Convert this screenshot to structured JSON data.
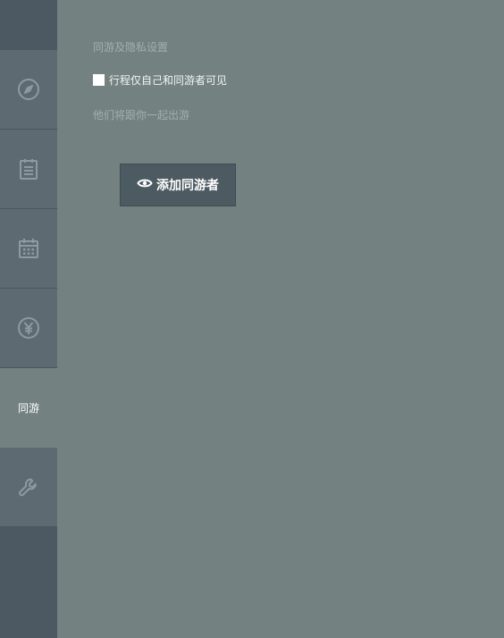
{
  "sidebar": {
    "items": [
      {
        "icon": "compass-icon",
        "label": ""
      },
      {
        "icon": "clipboard-icon",
        "label": ""
      },
      {
        "icon": "calendar-icon",
        "label": ""
      },
      {
        "icon": "yen-icon",
        "label": ""
      },
      {
        "icon": "",
        "label": "同游",
        "active": true
      },
      {
        "icon": "wrench-icon",
        "label": ""
      }
    ]
  },
  "main": {
    "section_title": "同游及隐私设置",
    "visibility_checkbox": {
      "label": "行程仅自己和同游者可见",
      "checked": false
    },
    "companions_subtitle": "他们将跟你一起出游",
    "add_button_label": "添加同游者",
    "add_button_icon": "eye-icon"
  },
  "colors": {
    "main_bg": "#738280",
    "sidebar_bg": "#4c5862",
    "sidebar_item_bg": "#5d6a72",
    "button_bg": "#4c5a62"
  }
}
